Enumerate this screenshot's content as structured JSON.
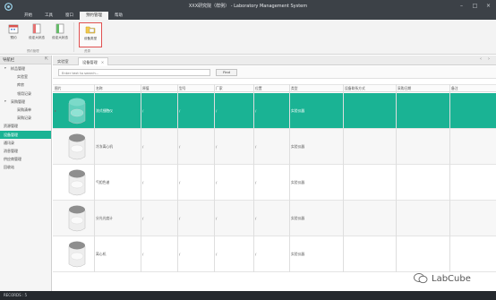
{
  "window": {
    "title": "XXX研究院（样例） - Laboratory Management System",
    "controls": [
      "minimize-icon",
      "maximize-icon",
      "close-icon"
    ]
  },
  "menu": [
    "开始",
    "工具",
    "窗口",
    "预约管理",
    "帮助"
  ],
  "ribbon": {
    "buttons": [
      "预约",
      "设定大状态",
      "设定大状态",
      "设备类型"
    ],
    "groups": [
      "预约管理",
      "资源"
    ]
  },
  "nav": {
    "title": "导航栏",
    "items": [
      {
        "label": "样品管理",
        "level": 1,
        "expanded": true
      },
      {
        "label": "实验室",
        "level": 2
      },
      {
        "label": "库房",
        "level": 2
      },
      {
        "label": "领用记录",
        "level": 2
      },
      {
        "label": "采购管理",
        "level": 1,
        "expanded": true
      },
      {
        "label": "采购清单",
        "level": 2
      },
      {
        "label": "采购记录",
        "level": 2
      },
      {
        "label": "资源管理",
        "level": 0
      },
      {
        "label": "设备管理",
        "level": 0,
        "active": true
      },
      {
        "label": "通讯录",
        "level": 0
      },
      {
        "label": "消息管理",
        "level": 0
      },
      {
        "label": "供应商管理",
        "level": 0
      },
      {
        "label": "回收站",
        "level": 0
      }
    ]
  },
  "tabs": [
    {
      "label": "实验室",
      "active": false
    },
    {
      "label": "设备管理",
      "active": true,
      "close": "×"
    }
  ],
  "toolbar": {
    "search_placeholder": "Enter text to search...",
    "find_label": "Find"
  },
  "grid": {
    "columns": [
      "图片",
      "名称",
      "原值",
      "型号",
      "厂家",
      "位置",
      "类型",
      "设备联系方式",
      "采购日期",
      "备注"
    ],
    "rows": [
      {
        "name": "流式细胞仪",
        "values": [
          "/",
          "/",
          "/",
          "/",
          "实验仪器"
        ],
        "selected": true
      },
      {
        "name": "冷冻离心机",
        "values": [
          "/",
          "/",
          "/",
          "/",
          "实验仪器"
        ]
      },
      {
        "name": "气相色谱",
        "values": [
          "/",
          "/",
          "/",
          "/",
          "实验仪器"
        ]
      },
      {
        "name": "分光光度计",
        "values": [
          "/",
          "/",
          "/",
          "/",
          "实验仪器"
        ]
      },
      {
        "name": "离心机",
        "values": [
          "/",
          "/",
          "/",
          "/",
          "实验仪器"
        ]
      }
    ]
  },
  "status": {
    "text": "RECORDS : 5"
  },
  "watermark": {
    "text": "LabCube"
  },
  "colors": {
    "accent": "#1ab394",
    "titlebar": "#3c4147",
    "statusbar": "#25292e"
  }
}
